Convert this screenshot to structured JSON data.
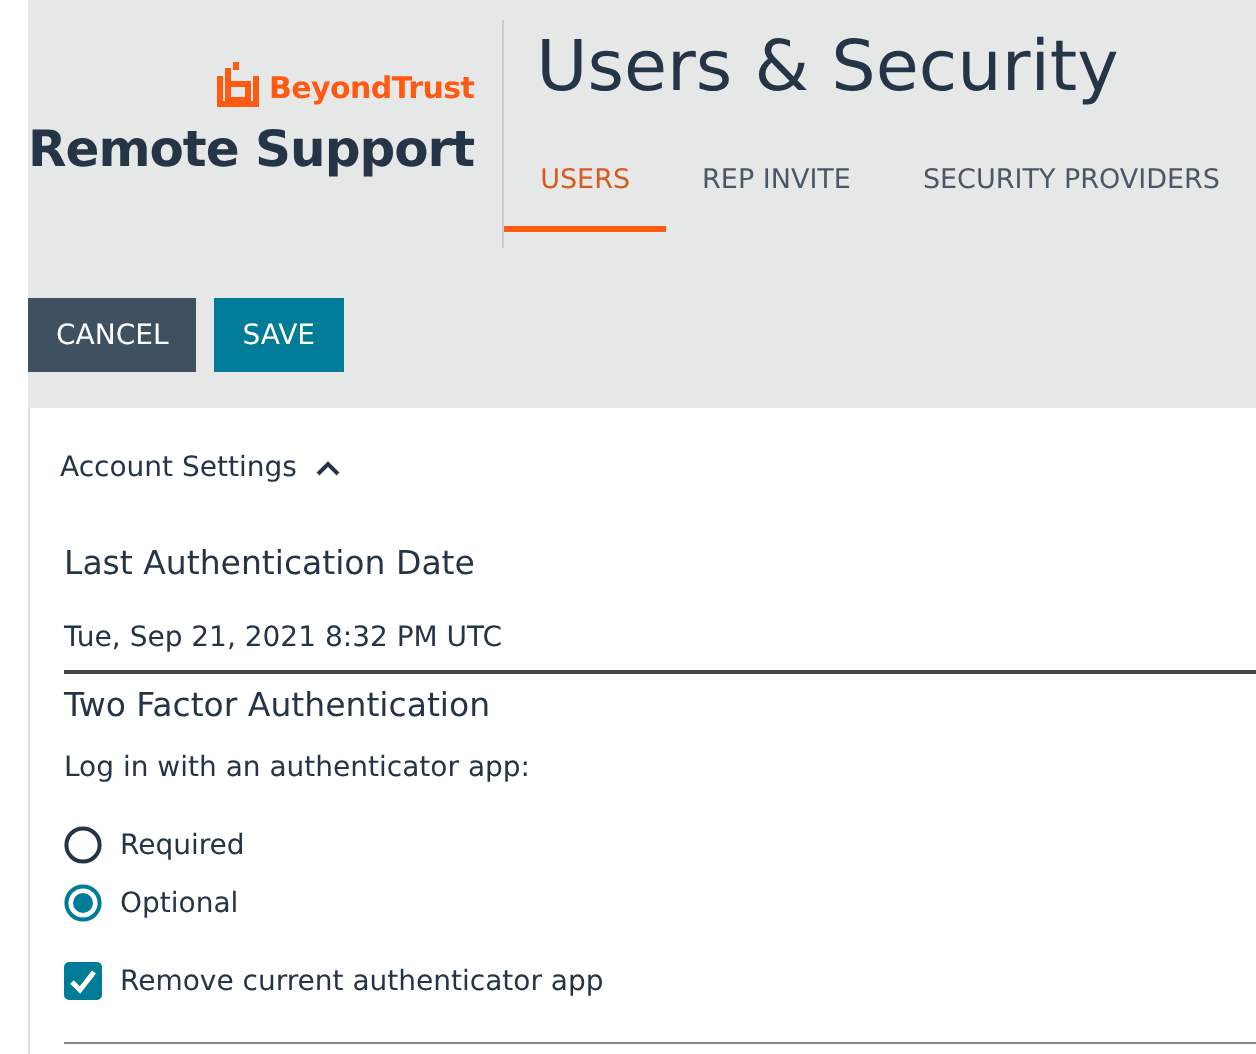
{
  "brand": {
    "company": "BeyondTrust",
    "product": "Remote Support"
  },
  "page_title": "Users & Security",
  "tabs": [
    {
      "label": "USERS",
      "selected": true
    },
    {
      "label": "REP INVITE",
      "selected": false
    },
    {
      "label": "SECURITY PROVIDERS",
      "selected": false
    }
  ],
  "buttons": [
    {
      "label": "CANCEL",
      "kind": "secondary"
    },
    {
      "label": "SAVE",
      "kind": "primary"
    }
  ],
  "section": {
    "title": "Account Settings",
    "expanded": true
  },
  "last_auth": {
    "label": "Last Authentication Date",
    "value": "Tue, Sep 21, 2021 8:32 PM UTC"
  },
  "two_factor": {
    "title": "Two Factor Authentication",
    "prompt": "Log in with an authenticator app:",
    "options": [
      {
        "label": "Required",
        "selected": false
      },
      {
        "label": "Optional",
        "selected": true
      }
    ],
    "remove_app": {
      "label": "Remove current authenticator app",
      "checked": true
    }
  }
}
